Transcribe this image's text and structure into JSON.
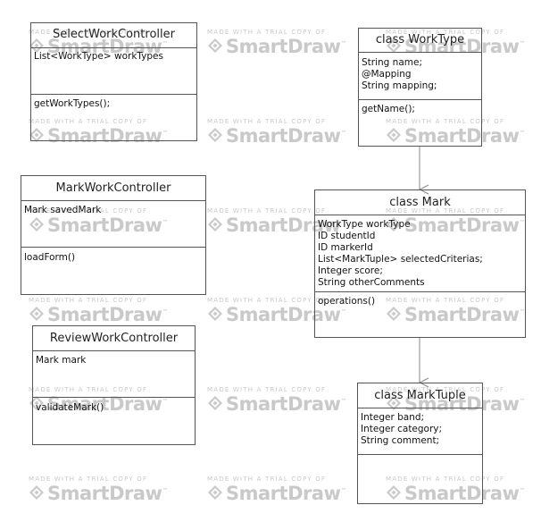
{
  "watermark": {
    "top_text": "MADE WITH A TRIAL COPY OF",
    "brand": "SmartDraw",
    "trademark": "™",
    "color": "#c9c9c9"
  },
  "classes": {
    "select_work_controller": {
      "name": "SelectWorkController",
      "attributes": [
        "List<WorkType> workTypes"
      ],
      "operations": [
        "getWorkTypes();"
      ]
    },
    "work_type": {
      "name": "class WorkType",
      "attributes": [
        "String name;",
        "@Mapping",
        "String mapping;"
      ],
      "operations": [
        "getName();"
      ]
    },
    "mark_work_controller": {
      "name": "MarkWorkController",
      "attributes": [
        "Mark savedMark"
      ],
      "operations": [
        "loadForm()"
      ]
    },
    "mark": {
      "name": "class Mark",
      "attributes": [
        "WorkType workType",
        "ID studentId",
        "ID markerId",
        "List<MarkTuple> selectedCriterias;",
        "Integer score;",
        "String otherComments"
      ],
      "operations": [
        "operations()"
      ]
    },
    "review_work_controller": {
      "name": "ReviewWorkController",
      "attributes": [
        "Mark mark"
      ],
      "operations": [
        "validateMark()"
      ]
    },
    "mark_tuple": {
      "name": "class MarkTuple",
      "attributes": [
        "Integer band;",
        "Integer category;",
        "String comment;"
      ],
      "operations": []
    }
  },
  "relations": [
    {
      "from": "mark",
      "to": "work_type",
      "type": "arrow"
    },
    {
      "from": "mark",
      "to": "mark_tuple",
      "type": "arrow"
    }
  ],
  "colors": {
    "border": "#555555",
    "link": "#888888",
    "text": "#111111"
  }
}
